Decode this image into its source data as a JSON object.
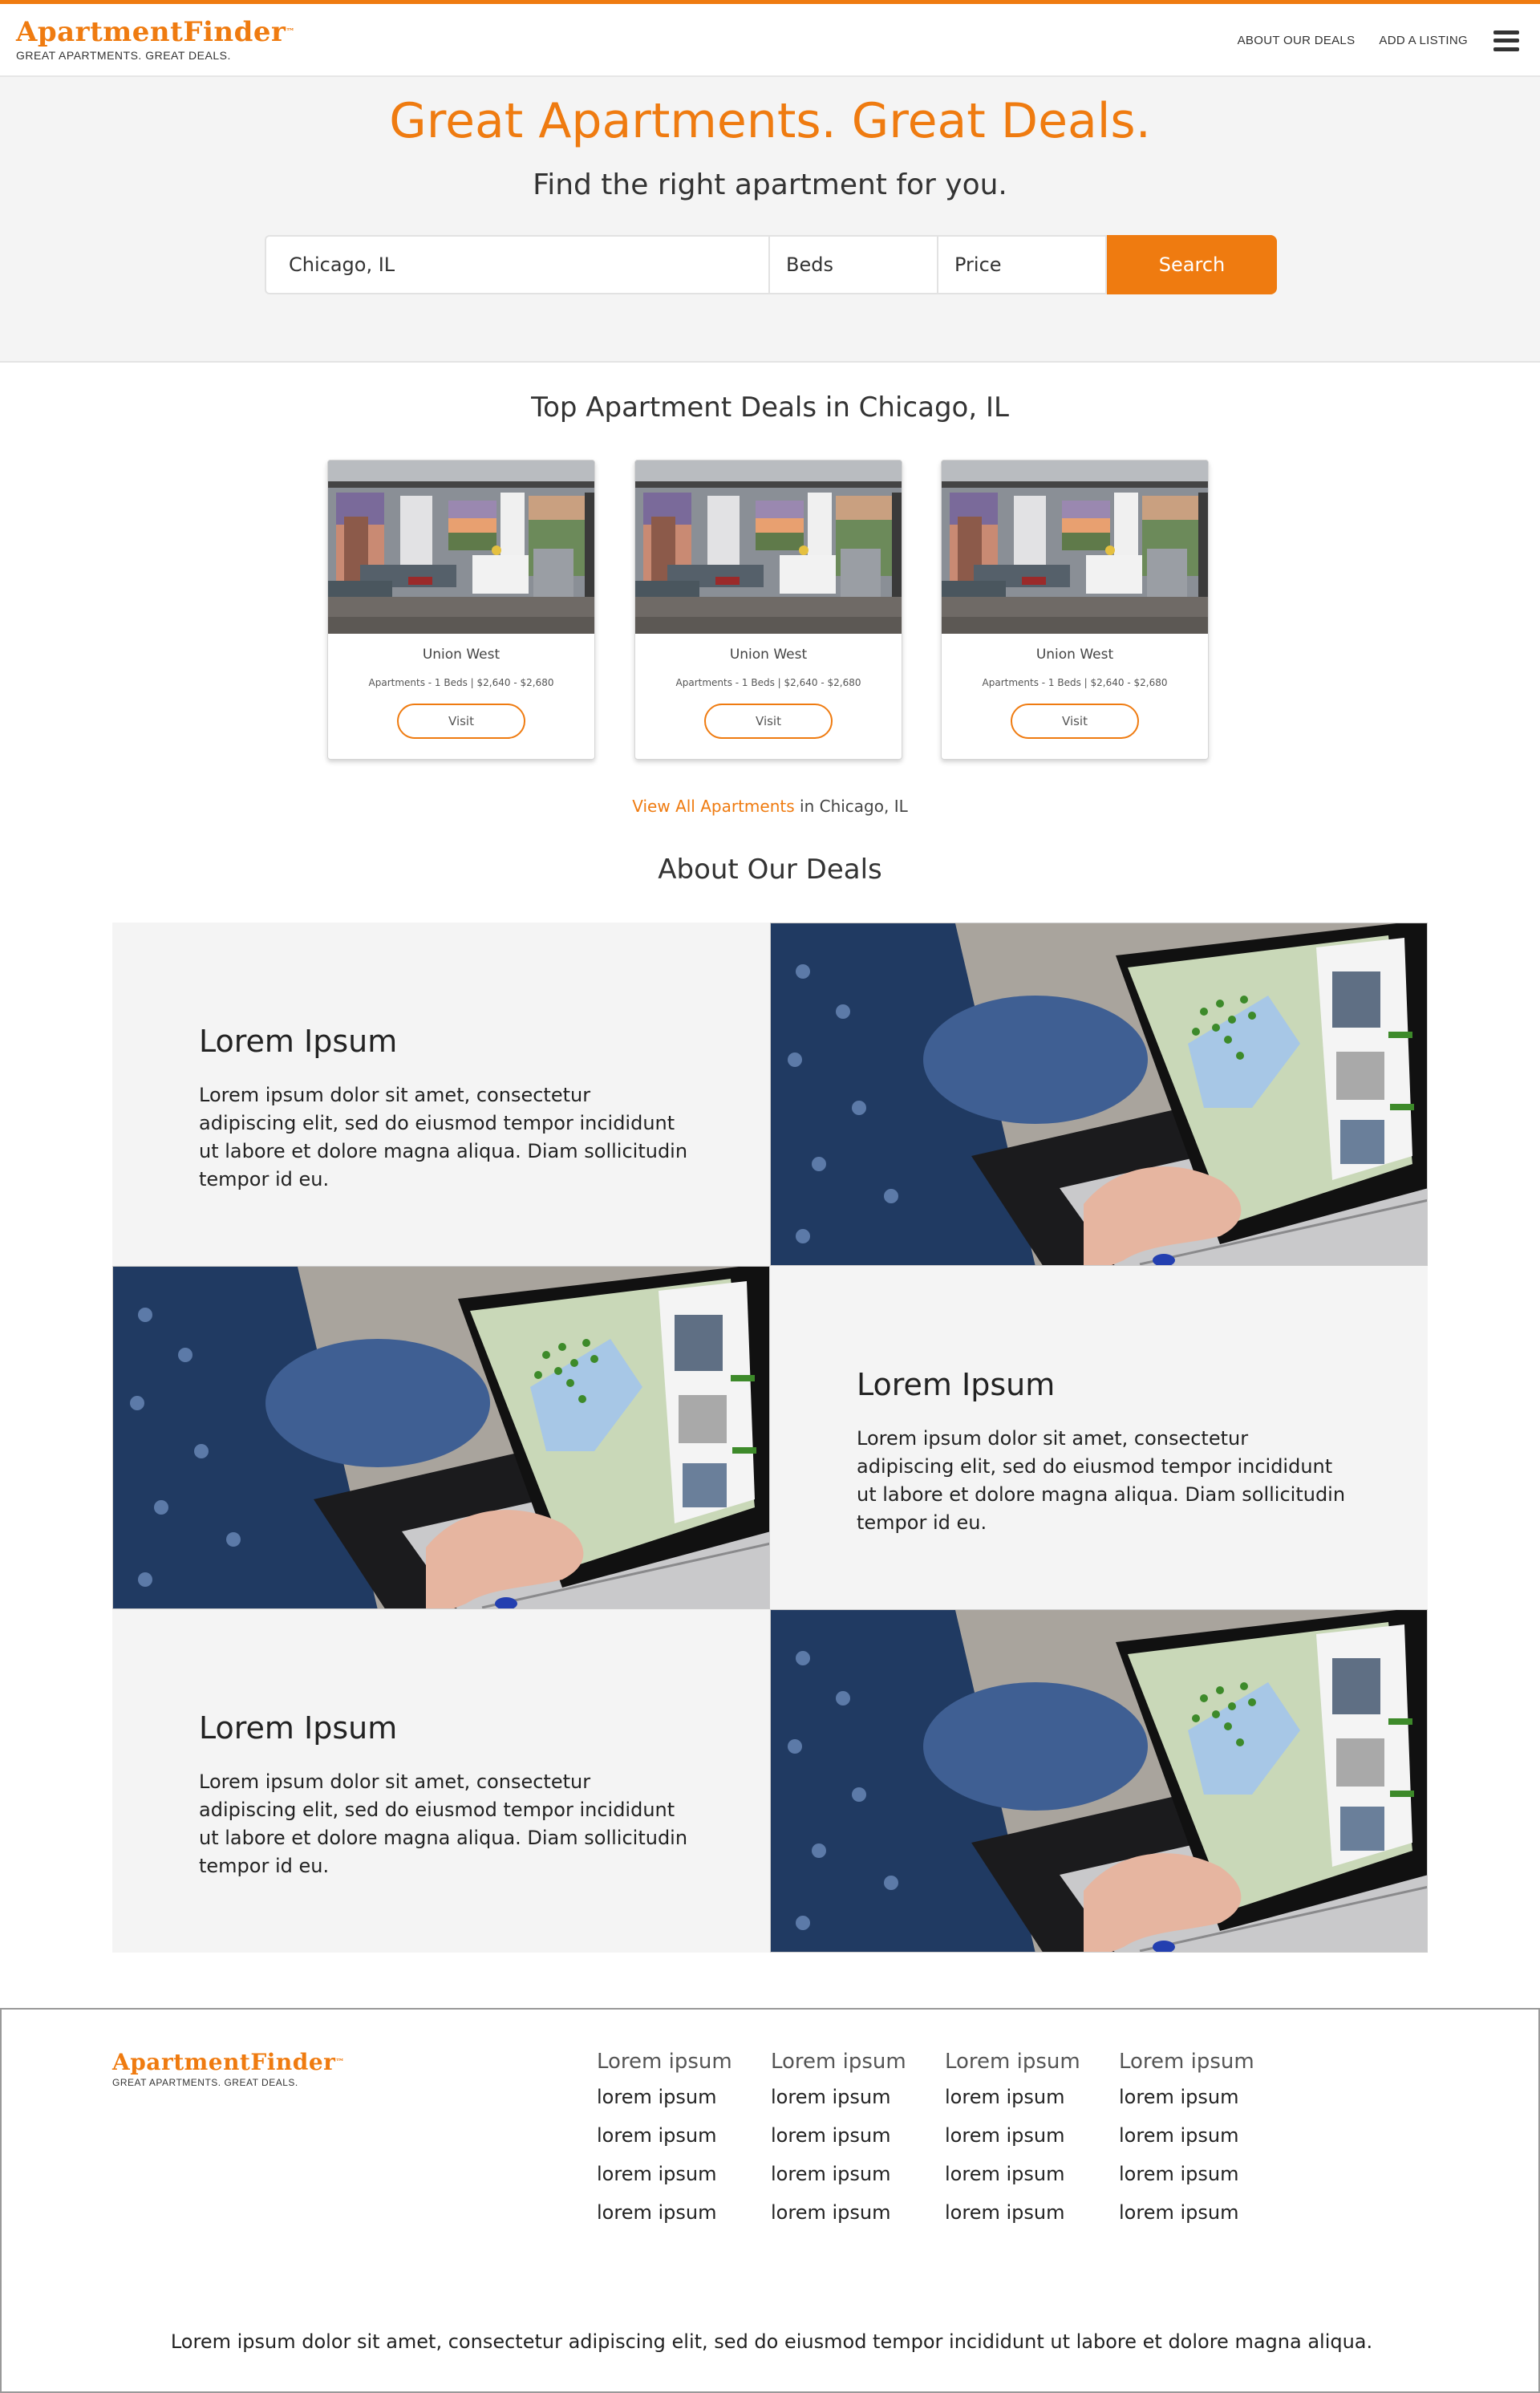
{
  "header": {
    "logo": "ApartmentFinder",
    "logo_tm": "™",
    "tagline": "GREAT APARTMENTS. GREAT DEALS.",
    "nav": [
      "ABOUT OUR DEALS",
      "ADD A LISTING"
    ],
    "menu_icon": "hamburger-menu-icon"
  },
  "hero": {
    "title": "Great Apartments. Great Deals.",
    "subtitle": "Find the right apartment for you.",
    "location_value": "Chicago, IL",
    "beds_label": "Beds",
    "price_label": "Price",
    "search_label": "Search"
  },
  "deals": {
    "title": "Top Apartment Deals in Chicago, IL",
    "cards": [
      {
        "name": "Union West",
        "desc": "Apartments - 1 Beds | $2,640 - $2,680",
        "button": "Visit"
      },
      {
        "name": "Union West",
        "desc": "Apartments - 1 Beds | $2,640 - $2,680",
        "button": "Visit"
      },
      {
        "name": "Union West",
        "desc": "Apartments - 1 Beds | $2,640 - $2,680",
        "button": "Visit"
      }
    ],
    "view_all_link": "View All Apartments",
    "view_all_rest": " in Chicago, IL"
  },
  "about": {
    "title": "About Our Deals",
    "blocks": [
      {
        "heading": "Lorem Ipsum",
        "text": "Lorem ipsum dolor sit amet, consectetur adipiscing elit, sed do eiusmod tempor incididunt ut labore et dolore magna aliqua. Diam sollicitudin tempor id eu."
      },
      {
        "heading": "Lorem Ipsum",
        "text": "Lorem ipsum dolor sit amet, consectetur adipiscing elit, sed do eiusmod tempor incididunt ut labore et dolore magna aliqua. Diam sollicitudin tempor id eu."
      },
      {
        "heading": "Lorem Ipsum",
        "text": "Lorem ipsum dolor sit amet, consectetur adipiscing elit, sed do eiusmod tempor incididunt ut labore et dolore magna aliqua. Diam sollicitudin tempor id eu."
      }
    ]
  },
  "footer": {
    "logo": "ApartmentFinder",
    "logo_tm": "™",
    "tagline": "GREAT APARTMENTS. GREAT DEALS.",
    "columns": [
      {
        "head": "Lorem ipsum",
        "items": [
          "lorem ipsum",
          "lorem ipsum",
          "lorem ipsum",
          "lorem ipsum"
        ]
      },
      {
        "head": "Lorem ipsum",
        "items": [
          "lorem ipsum",
          "lorem ipsum",
          "lorem ipsum",
          "lorem ipsum"
        ]
      },
      {
        "head": "Lorem ipsum",
        "items": [
          "lorem ipsum",
          "lorem ipsum",
          "lorem ipsum",
          "lorem ipsum"
        ]
      },
      {
        "head": "Lorem ipsum",
        "items": [
          "lorem ipsum",
          "lorem ipsum",
          "lorem ipsum",
          "lorem ipsum"
        ]
      }
    ],
    "bottom_text": "Lorem ipsum dolor sit amet, consectetur adipiscing elit, sed do eiusmod tempor incididunt ut labore et dolore magna aliqua."
  },
  "colors": {
    "accent": "#ef7b10",
    "hero_bg": "#f4f4f4",
    "tile_bg": "#f4f4f4"
  }
}
